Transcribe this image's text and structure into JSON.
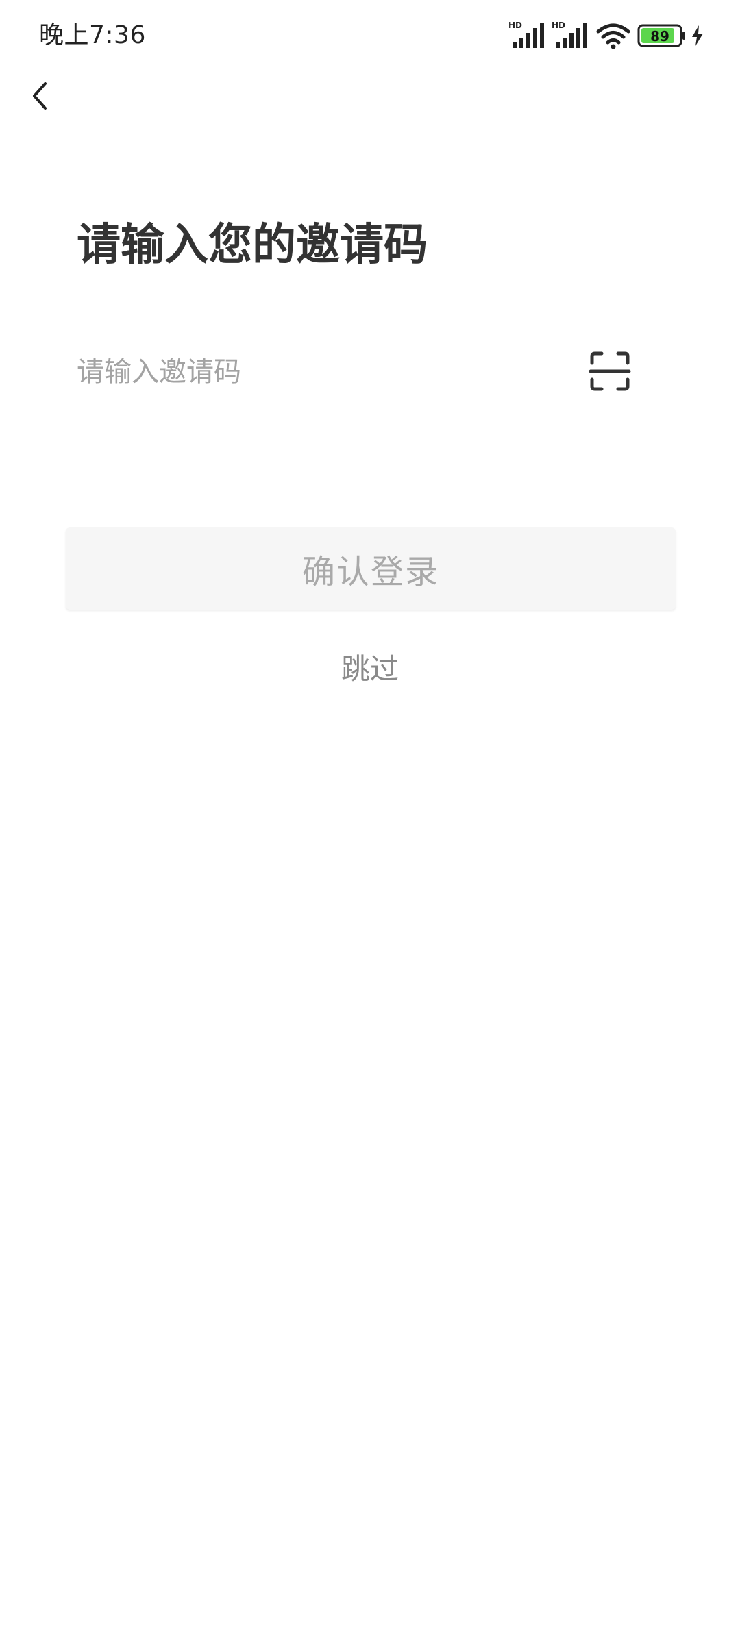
{
  "status_bar": {
    "time": "晚上7:36",
    "signal_1_label": "HD",
    "signal_2_label": "HD",
    "battery_level": "89",
    "battery_color": "#5cd64d",
    "icons": [
      "signal-icon",
      "signal-icon",
      "wifi-icon",
      "battery-icon",
      "charging-icon"
    ]
  },
  "nav": {
    "back_icon": "chevron-left-icon"
  },
  "page": {
    "title": "请输入您的邀请码"
  },
  "invite_field": {
    "value": "",
    "placeholder": "请输入邀请码",
    "scan_icon": "scan-icon"
  },
  "actions": {
    "confirm_label": "确认登录",
    "skip_label": "跳过"
  }
}
